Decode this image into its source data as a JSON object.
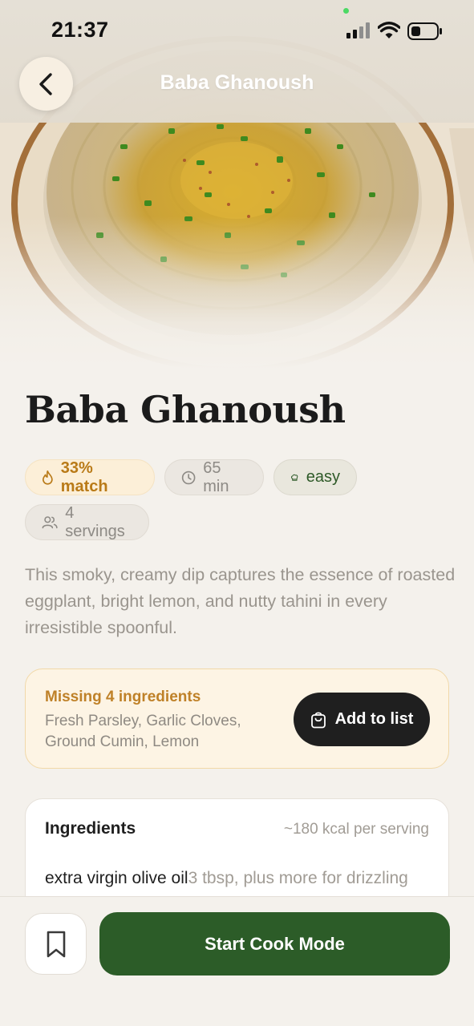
{
  "status_bar": {
    "time": "21:37"
  },
  "nav": {
    "title": "Baba Ghanoush"
  },
  "recipe": {
    "title": "Baba Ghanoush",
    "chips": {
      "match": "33% match",
      "time": "65 min",
      "difficulty": "easy",
      "servings": "4 servings"
    },
    "description": "This smoky, creamy dip captures the essence of roasted eggplant, bright lemon, and nutty tahini in every irresistible spoonful."
  },
  "missing": {
    "heading": "Missing 4 ingredients",
    "items": "Fresh Parsley, Garlic Cloves, Ground Cumin, Lemon",
    "button_label": "Add to list"
  },
  "ingredients": {
    "heading": "Ingredients",
    "kcal": "~180 kcal per serving",
    "items": [
      {
        "name": "extra virgin olive oil",
        "quantity": "3 tbsp, plus more for drizzling"
      }
    ]
  },
  "bottom_bar": {
    "cook_label": "Start Cook Mode"
  },
  "colors": {
    "accent_green": "#2c5c28",
    "match_amber": "#b97a17",
    "background": "#f4f1ec"
  },
  "icons": {
    "back": "chevron-left-icon",
    "match": "flame-icon",
    "time": "clock-icon",
    "difficulty": "chef-hat-icon",
    "servings": "users-icon",
    "add_to_list": "shopping-bag-icon",
    "bookmark": "bookmark-icon"
  }
}
